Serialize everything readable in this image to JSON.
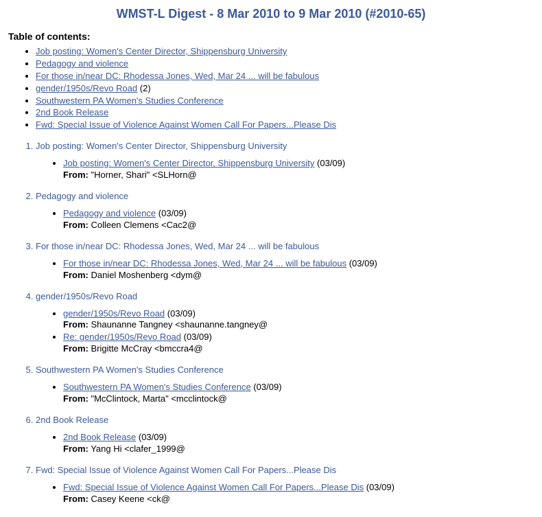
{
  "title": "WMST-L Digest - 8 Mar 2010 to 9 Mar 2010 (#2010-65)",
  "toc_label": "Table of contents:",
  "from_label": "From:",
  "toc": [
    {
      "label": "Job posting: Women's Center Director, Shippensburg University",
      "count": null
    },
    {
      "label": "Pedagogy and violence",
      "count": null
    },
    {
      "label": "For those in/near DC: Rhodessa Jones, Wed, Mar 24 ... will be fabulous",
      "count": null
    },
    {
      "label": "gender/1950s/Revo Road",
      "count": "(2)"
    },
    {
      "label": "Southwestern PA Women's Studies Conference",
      "count": null
    },
    {
      "label": "2nd Book Release",
      "count": null
    },
    {
      "label": "Fwd: Special Issue of Violence Against Women Call For Papers...Please Dis",
      "count": null
    }
  ],
  "sections": [
    {
      "title": "Job posting: Women's Center Director, Shippensburg University",
      "messages": [
        {
          "subject": "Job posting: Women's Center Director, Shippensburg University",
          "date": "(03/09)",
          "from": "\"Horner, Shari\" <SLHorn@"
        }
      ]
    },
    {
      "title": "Pedagogy and violence",
      "messages": [
        {
          "subject": "Pedagogy and violence",
          "date": "(03/09)",
          "from": "Colleen Clemens <Cac2@"
        }
      ]
    },
    {
      "title": "For those in/near DC: Rhodessa Jones, Wed, Mar 24 ... will be fabulous",
      "messages": [
        {
          "subject": "For those in/near DC: Rhodessa Jones, Wed, Mar 24 ... will be fabulous",
          "date": "(03/09)",
          "from": "Daniel Moshenberg <dym@"
        }
      ]
    },
    {
      "title": "gender/1950s/Revo Road",
      "messages": [
        {
          "subject": "gender/1950s/Revo Road",
          "date": "(03/09)",
          "from": "Shaunanne Tangney <shaunanne.tangney@"
        },
        {
          "subject": "Re: gender/1950s/Revo Road",
          "date": "(03/09)",
          "from": "Brigitte McCray <bmccra4@"
        }
      ]
    },
    {
      "title": "Southwestern PA Women's Studies Conference",
      "messages": [
        {
          "subject": "Southwestern PA Women's Studies Conference",
          "date": "(03/09)",
          "from": "\"McClintock, Marta\" <mcclintock@"
        }
      ]
    },
    {
      "title": "2nd Book Release",
      "messages": [
        {
          "subject": "2nd Book Release",
          "date": "(03/09)",
          "from": "Yang Hi <clafer_1999@"
        }
      ]
    },
    {
      "title": "Fwd: Special Issue of Violence Against Women Call For Papers...Please Dis",
      "messages": [
        {
          "subject": "Fwd: Special Issue of Violence Against Women Call For Papers...Please Dis",
          "date": "(03/09)",
          "from": "Casey Keene <ck@"
        }
      ]
    }
  ]
}
